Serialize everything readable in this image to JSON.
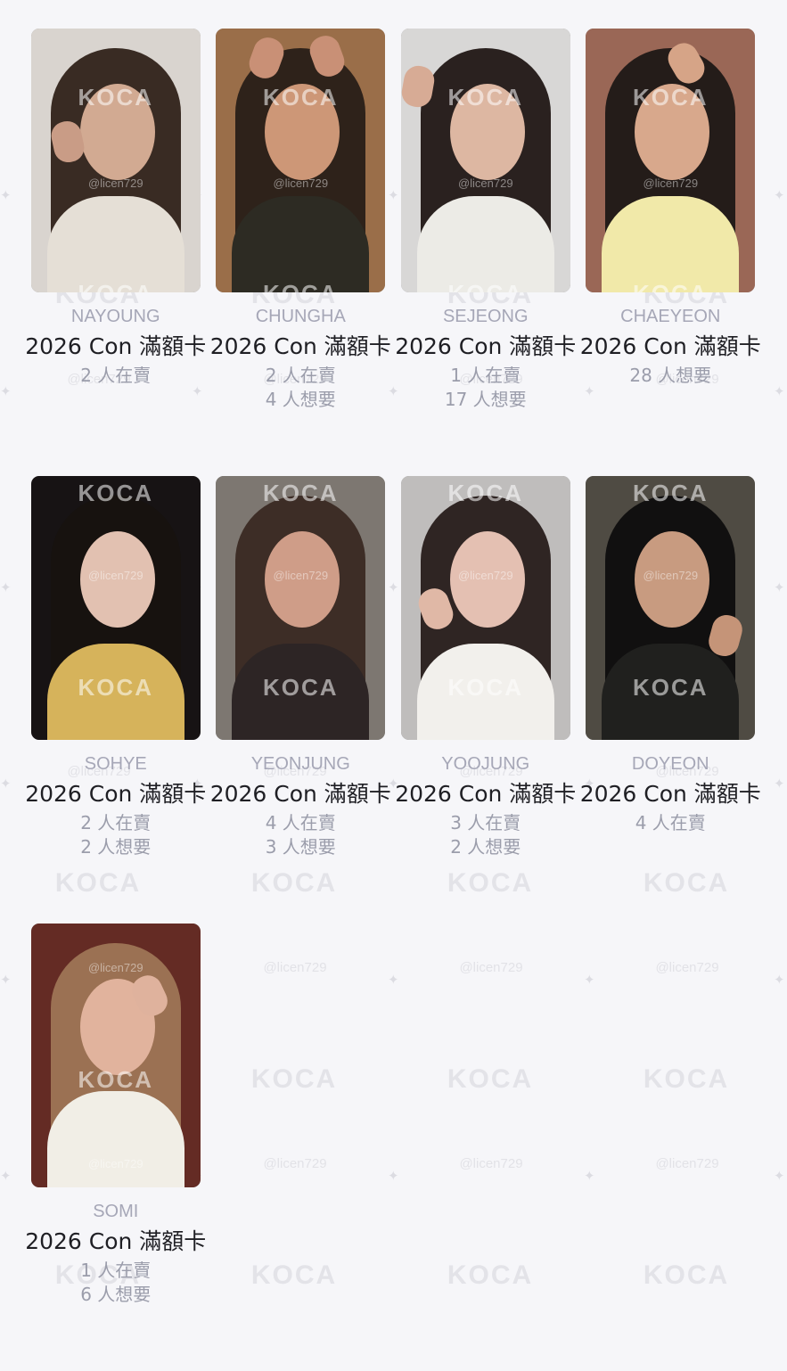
{
  "watermark": {
    "logo": "KOCA",
    "handle": "@licen729"
  },
  "cards": [
    {
      "member": "NAYOUNG",
      "title": "2026 Con 滿額卡",
      "selling": "2 人在賣",
      "wanting": "",
      "photo": {
        "bg": "#d9d4cf",
        "hair": "#392b23",
        "skin": "#d2aa92",
        "top": "#e5dfd6"
      }
    },
    {
      "member": "CHUNGHA",
      "title": "2026 Con 滿額卡",
      "selling": "2 人在賣",
      "wanting": "4 人想要",
      "photo": {
        "bg": "#9a6e49",
        "hair": "#2e221a",
        "skin": "#cd9777",
        "top": "#2d2b23"
      }
    },
    {
      "member": "SEJEONG",
      "title": "2026 Con 滿額卡",
      "selling": "1 人在賣",
      "wanting": "17 人想要",
      "photo": {
        "bg": "#d8d7d6",
        "hair": "#2a211f",
        "skin": "#ddb7a2",
        "top": "#ecebe6"
      }
    },
    {
      "member": "CHAEYEON",
      "title": "2026 Con 滿額卡",
      "selling": "28 人想要",
      "wanting": "",
      "photo": {
        "bg": "#9a6756",
        "hair": "#241c19",
        "skin": "#d8a88c",
        "top": "#f1e9a9"
      }
    },
    {
      "member": "SOHYE",
      "title": "2026 Con 滿額卡",
      "selling": "2 人在賣",
      "wanting": "2 人想要",
      "photo": {
        "bg": "#171314",
        "hair": "#17120f",
        "skin": "#e2c1b1",
        "top": "#d6b35b"
      }
    },
    {
      "member": "YEONJUNG",
      "title": "2026 Con 滿額卡",
      "selling": "4 人在賣",
      "wanting": "3 人想要",
      "photo": {
        "bg": "#7d7771",
        "hair": "#3d2d26",
        "skin": "#cf9d88",
        "top": "#2d2525"
      }
    },
    {
      "member": "YOOJUNG",
      "title": "2026 Con 滿額卡",
      "selling": "3 人在賣",
      "wanting": "2 人想要",
      "photo": {
        "bg": "#bfbdbc",
        "hair": "#2f2523",
        "skin": "#e4c0b2",
        "top": "#f2f0ec"
      }
    },
    {
      "member": "DOYEON",
      "title": "2026 Con 滿額卡",
      "selling": "4 人在賣",
      "wanting": "",
      "photo": {
        "bg": "#4f4b43",
        "hair": "#111010",
        "skin": "#c89b80",
        "top": "#20201e"
      }
    },
    {
      "member": "SOMI",
      "title": "2026 Con 滿額卡",
      "selling": "1 人在賣",
      "wanting": "6 人想要",
      "photo": {
        "bg": "#642b24",
        "hair": "#9b7153",
        "skin": "#e1b39d",
        "top": "#f1eee6"
      }
    }
  ]
}
